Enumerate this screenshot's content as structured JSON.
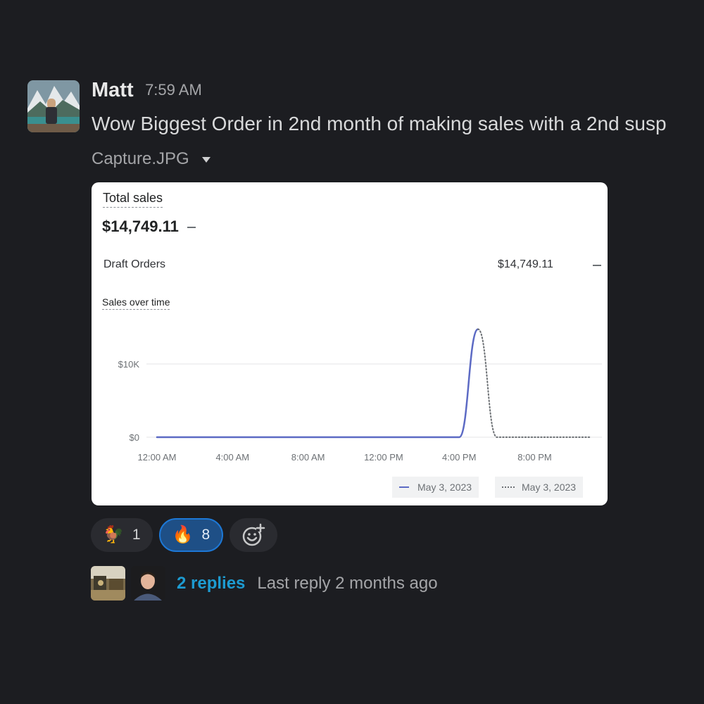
{
  "message": {
    "author": "Matt",
    "time": "7:59 AM",
    "text": "Wow Biggest Order in 2nd month of making sales with a 2nd susp",
    "attachment": {
      "file_name": "Capture.JPG",
      "image": {
        "title": "Total sales",
        "total": "$14,749.11",
        "breakdown_label": "Draft Orders",
        "breakdown_value": "$14,749.11",
        "chart_title": "Sales over time",
        "chart_data": {
          "type": "line",
          "title": "Sales over time",
          "xlabel": "",
          "ylabel": "",
          "x_ticks": [
            "12:00 AM",
            "4:00 AM",
            "8:00 AM",
            "12:00 PM",
            "4:00 PM",
            "8:00 PM"
          ],
          "y_ticks": [
            "$0",
            "$10K"
          ],
          "ylim": [
            0,
            15000
          ],
          "grid": true,
          "legend_position": "bottom-right",
          "series": [
            {
              "name": "May 3, 2023",
              "style": "solid",
              "color": "#5c6ac4",
              "x": [
                0,
                1,
                2,
                3,
                4,
                5,
                6,
                7,
                8,
                9,
                10,
                11,
                12,
                13,
                14,
                15,
                16,
                17
              ],
              "y": [
                0,
                0,
                0,
                0,
                0,
                0,
                0,
                0,
                0,
                0,
                0,
                0,
                0,
                0,
                0,
                0,
                0,
                14749.11
              ]
            },
            {
              "name": "May 3, 2023",
              "style": "dotted",
              "color": "#6d7175",
              "x": [
                17,
                18,
                19,
                20,
                21,
                22,
                23
              ],
              "y": [
                14749.11,
                0,
                0,
                0,
                0,
                0,
                0
              ]
            }
          ]
        }
      }
    },
    "reactions": [
      {
        "emoji": "🐓",
        "count": "1",
        "active": false
      },
      {
        "emoji": "🔥",
        "count": "8",
        "active": true
      }
    ],
    "thread": {
      "replies": "2 replies",
      "last_reply": "Last reply 2 months ago"
    }
  },
  "colors": {
    "background": "#1c1d21",
    "link": "#1d9bd1",
    "active_reaction": "#1e4f86"
  }
}
